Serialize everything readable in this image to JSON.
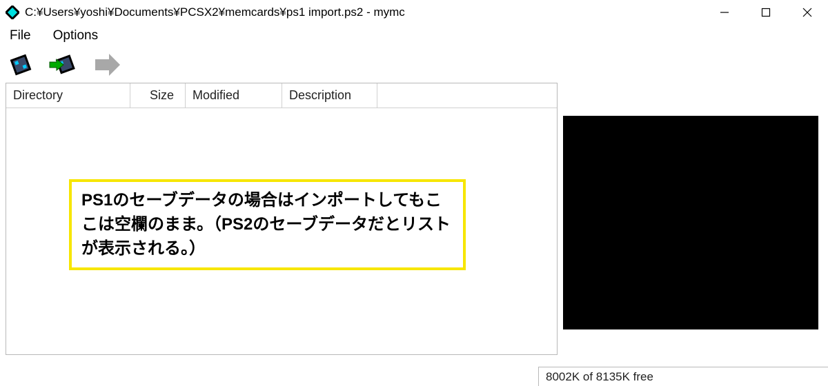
{
  "titlebar": {
    "title": "C:¥Users¥yoshi¥Documents¥PCSX2¥memcards¥ps1 import.ps2 - mymc"
  },
  "menubar": {
    "file": "File",
    "options": "Options"
  },
  "toolbar": {
    "open_name": "open-card",
    "import_name": "import-save",
    "export_name": "export-save"
  },
  "table": {
    "headers": {
      "directory": "Directory",
      "size": "Size",
      "modified": "Modified",
      "description": "Description"
    }
  },
  "statusbar": {
    "text": "8002K of 8135K free"
  },
  "annotation": {
    "text": "PS1のセーブデータの場合はインポートしてもここは空欄のまま。（PS2のセーブデータだとリストが表示される。）"
  }
}
